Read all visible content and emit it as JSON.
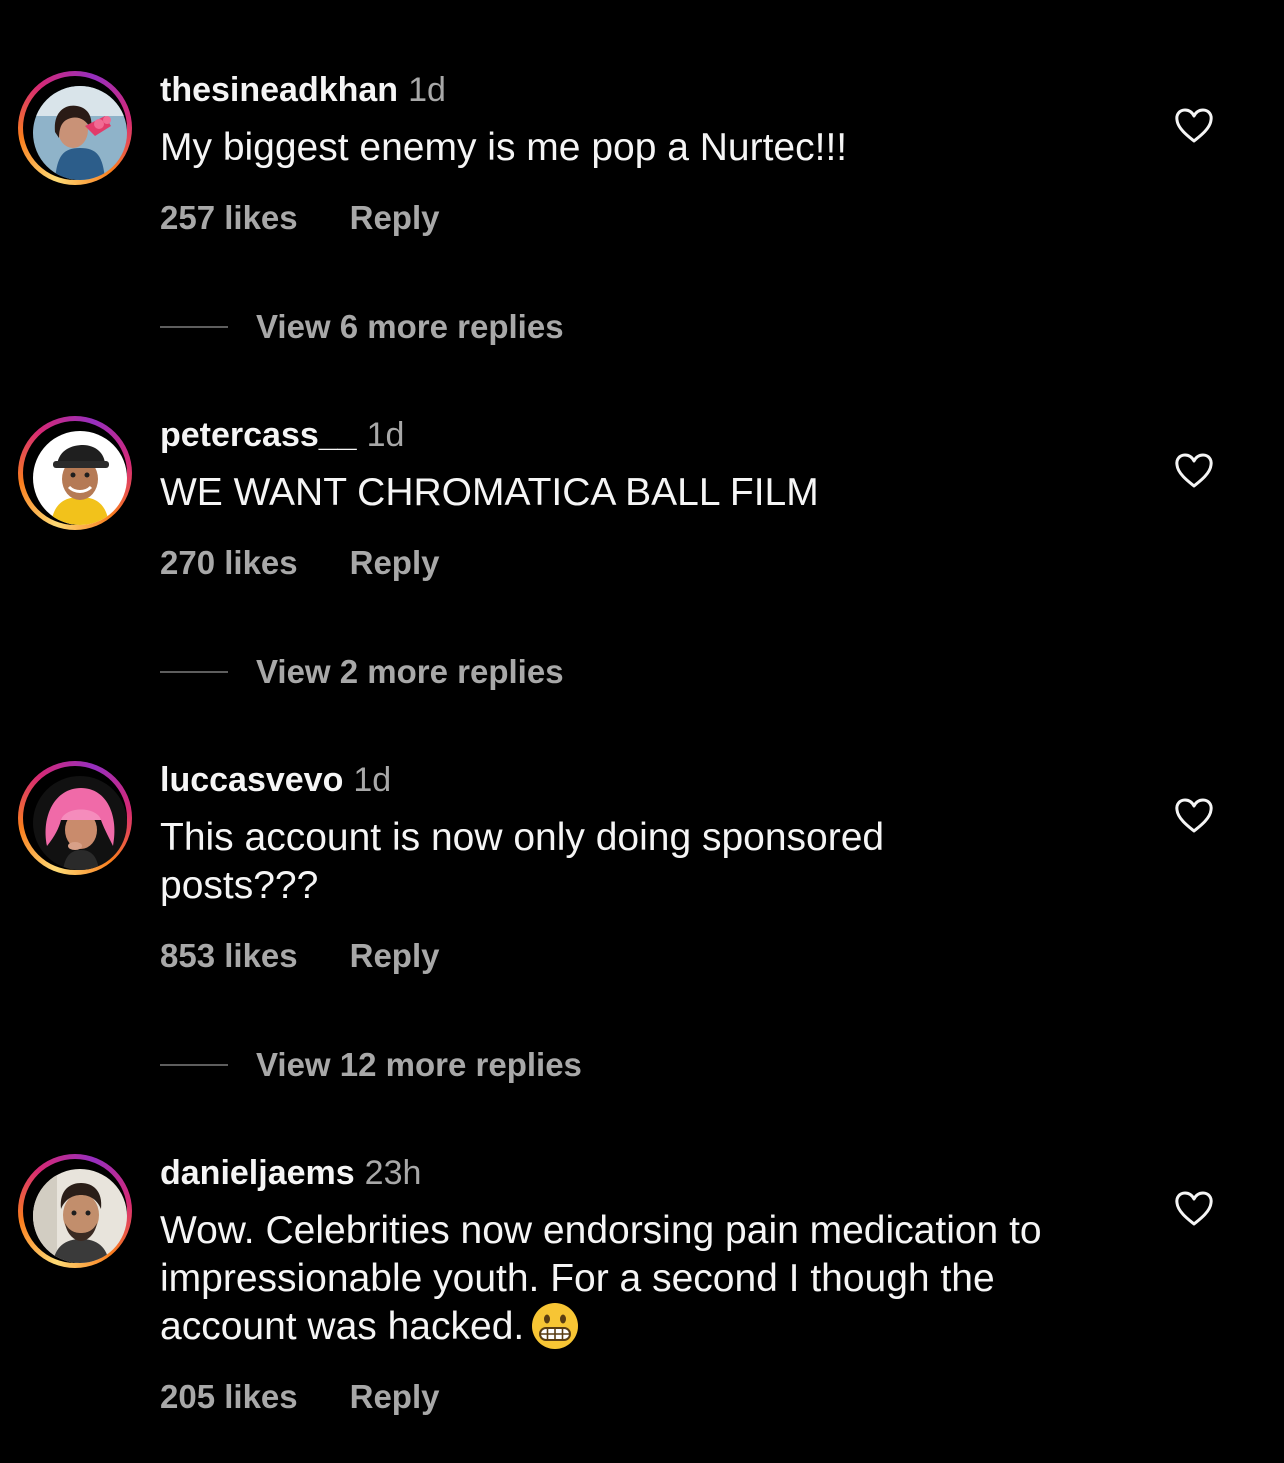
{
  "comments": [
    {
      "username": "thesineadkhan",
      "time": "1d",
      "text": "My biggest enemy is me pop a Nurtec!!!",
      "likes": "257 likes",
      "reply_label": "Reply",
      "view_replies": "View 6 more replies",
      "avatar_icon": "avatar-woman-pink-sunglasses"
    },
    {
      "username": "petercass__",
      "time": "1d",
      "text": "WE WANT CHROMATICA BALL FILM",
      "likes": "270 likes",
      "reply_label": "Reply",
      "view_replies": "View 2 more replies",
      "avatar_icon": "avatar-man-cap-yellow-hoodie"
    },
    {
      "username": "luccasvevo",
      "time": "1d",
      "text": "This account is now only doing sponsored posts???",
      "likes": "853 likes",
      "reply_label": "Reply",
      "view_replies": "View 12 more replies",
      "avatar_icon": "avatar-pink-wig"
    },
    {
      "username": "danieljaems",
      "time": "23h",
      "text": "Wow. Celebrities now endorsing pain medication to impressionable youth. For a second I though the account was hacked.",
      "likes": "205 likes",
      "reply_label": "Reply",
      "avatar_icon": "avatar-man-beard",
      "emoji": "grimacing-face-emoji"
    }
  ],
  "colors": {
    "background": "#000000",
    "primary_text": "#f5f5f5",
    "secondary_text": "#a8a8a8",
    "divider": "#5e5e5e",
    "story_ring": [
      "#feda75",
      "#fa7e1e",
      "#d62976",
      "#962fbf"
    ]
  },
  "icons": {
    "like": "heart-outline-icon"
  }
}
